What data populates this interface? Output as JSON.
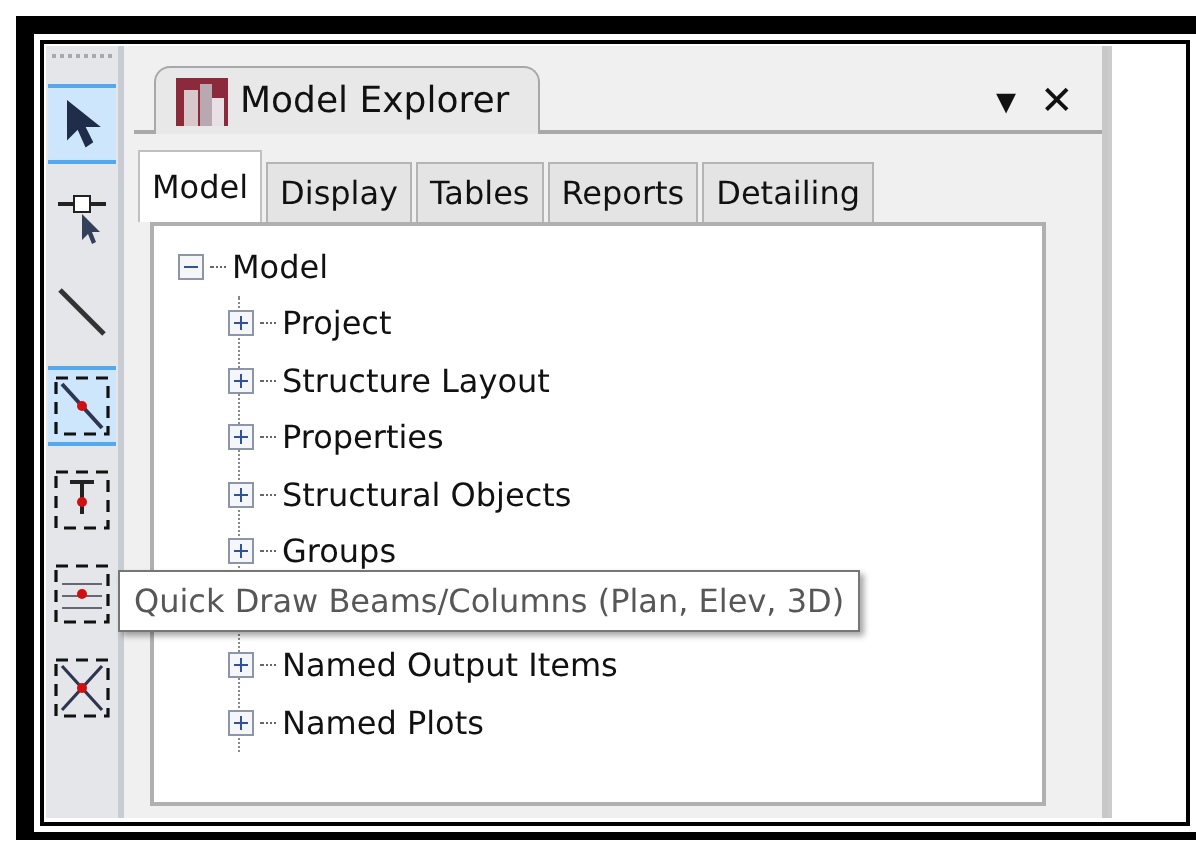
{
  "toolbar": {
    "tools": [
      {
        "kind": "pointer",
        "selected": true
      },
      {
        "kind": "reshape",
        "selected": false
      },
      {
        "kind": "line",
        "selected": false
      },
      {
        "kind": "diagonal",
        "selected": true
      },
      {
        "kind": "column",
        "selected": false
      },
      {
        "kind": "lines",
        "selected": false
      },
      {
        "kind": "cross",
        "selected": false
      }
    ]
  },
  "panel": {
    "title": "Model Explorer",
    "menu_glyph": "▾",
    "close_glyph": "✕",
    "tabs": [
      {
        "label": "Model",
        "selected": true
      },
      {
        "label": "Display",
        "selected": false
      },
      {
        "label": "Tables",
        "selected": false
      },
      {
        "label": "Reports",
        "selected": false
      },
      {
        "label": "Detailing",
        "selected": false
      }
    ],
    "tree": {
      "label": "Model",
      "expanded": true,
      "children": [
        {
          "label": "Project",
          "expanded": false
        },
        {
          "label": "Structure Layout",
          "expanded": false
        },
        {
          "label": "Properties",
          "expanded": false
        },
        {
          "label": "Structural Objects",
          "expanded": false
        },
        {
          "label": "Groups",
          "expanded": false
        },
        {
          "label": "Named Output Items",
          "expanded": false
        },
        {
          "label": "Named Plots",
          "expanded": false
        }
      ]
    }
  },
  "tooltip": "Quick Draw Beams/Columns (Plan, Elev, 3D)"
}
